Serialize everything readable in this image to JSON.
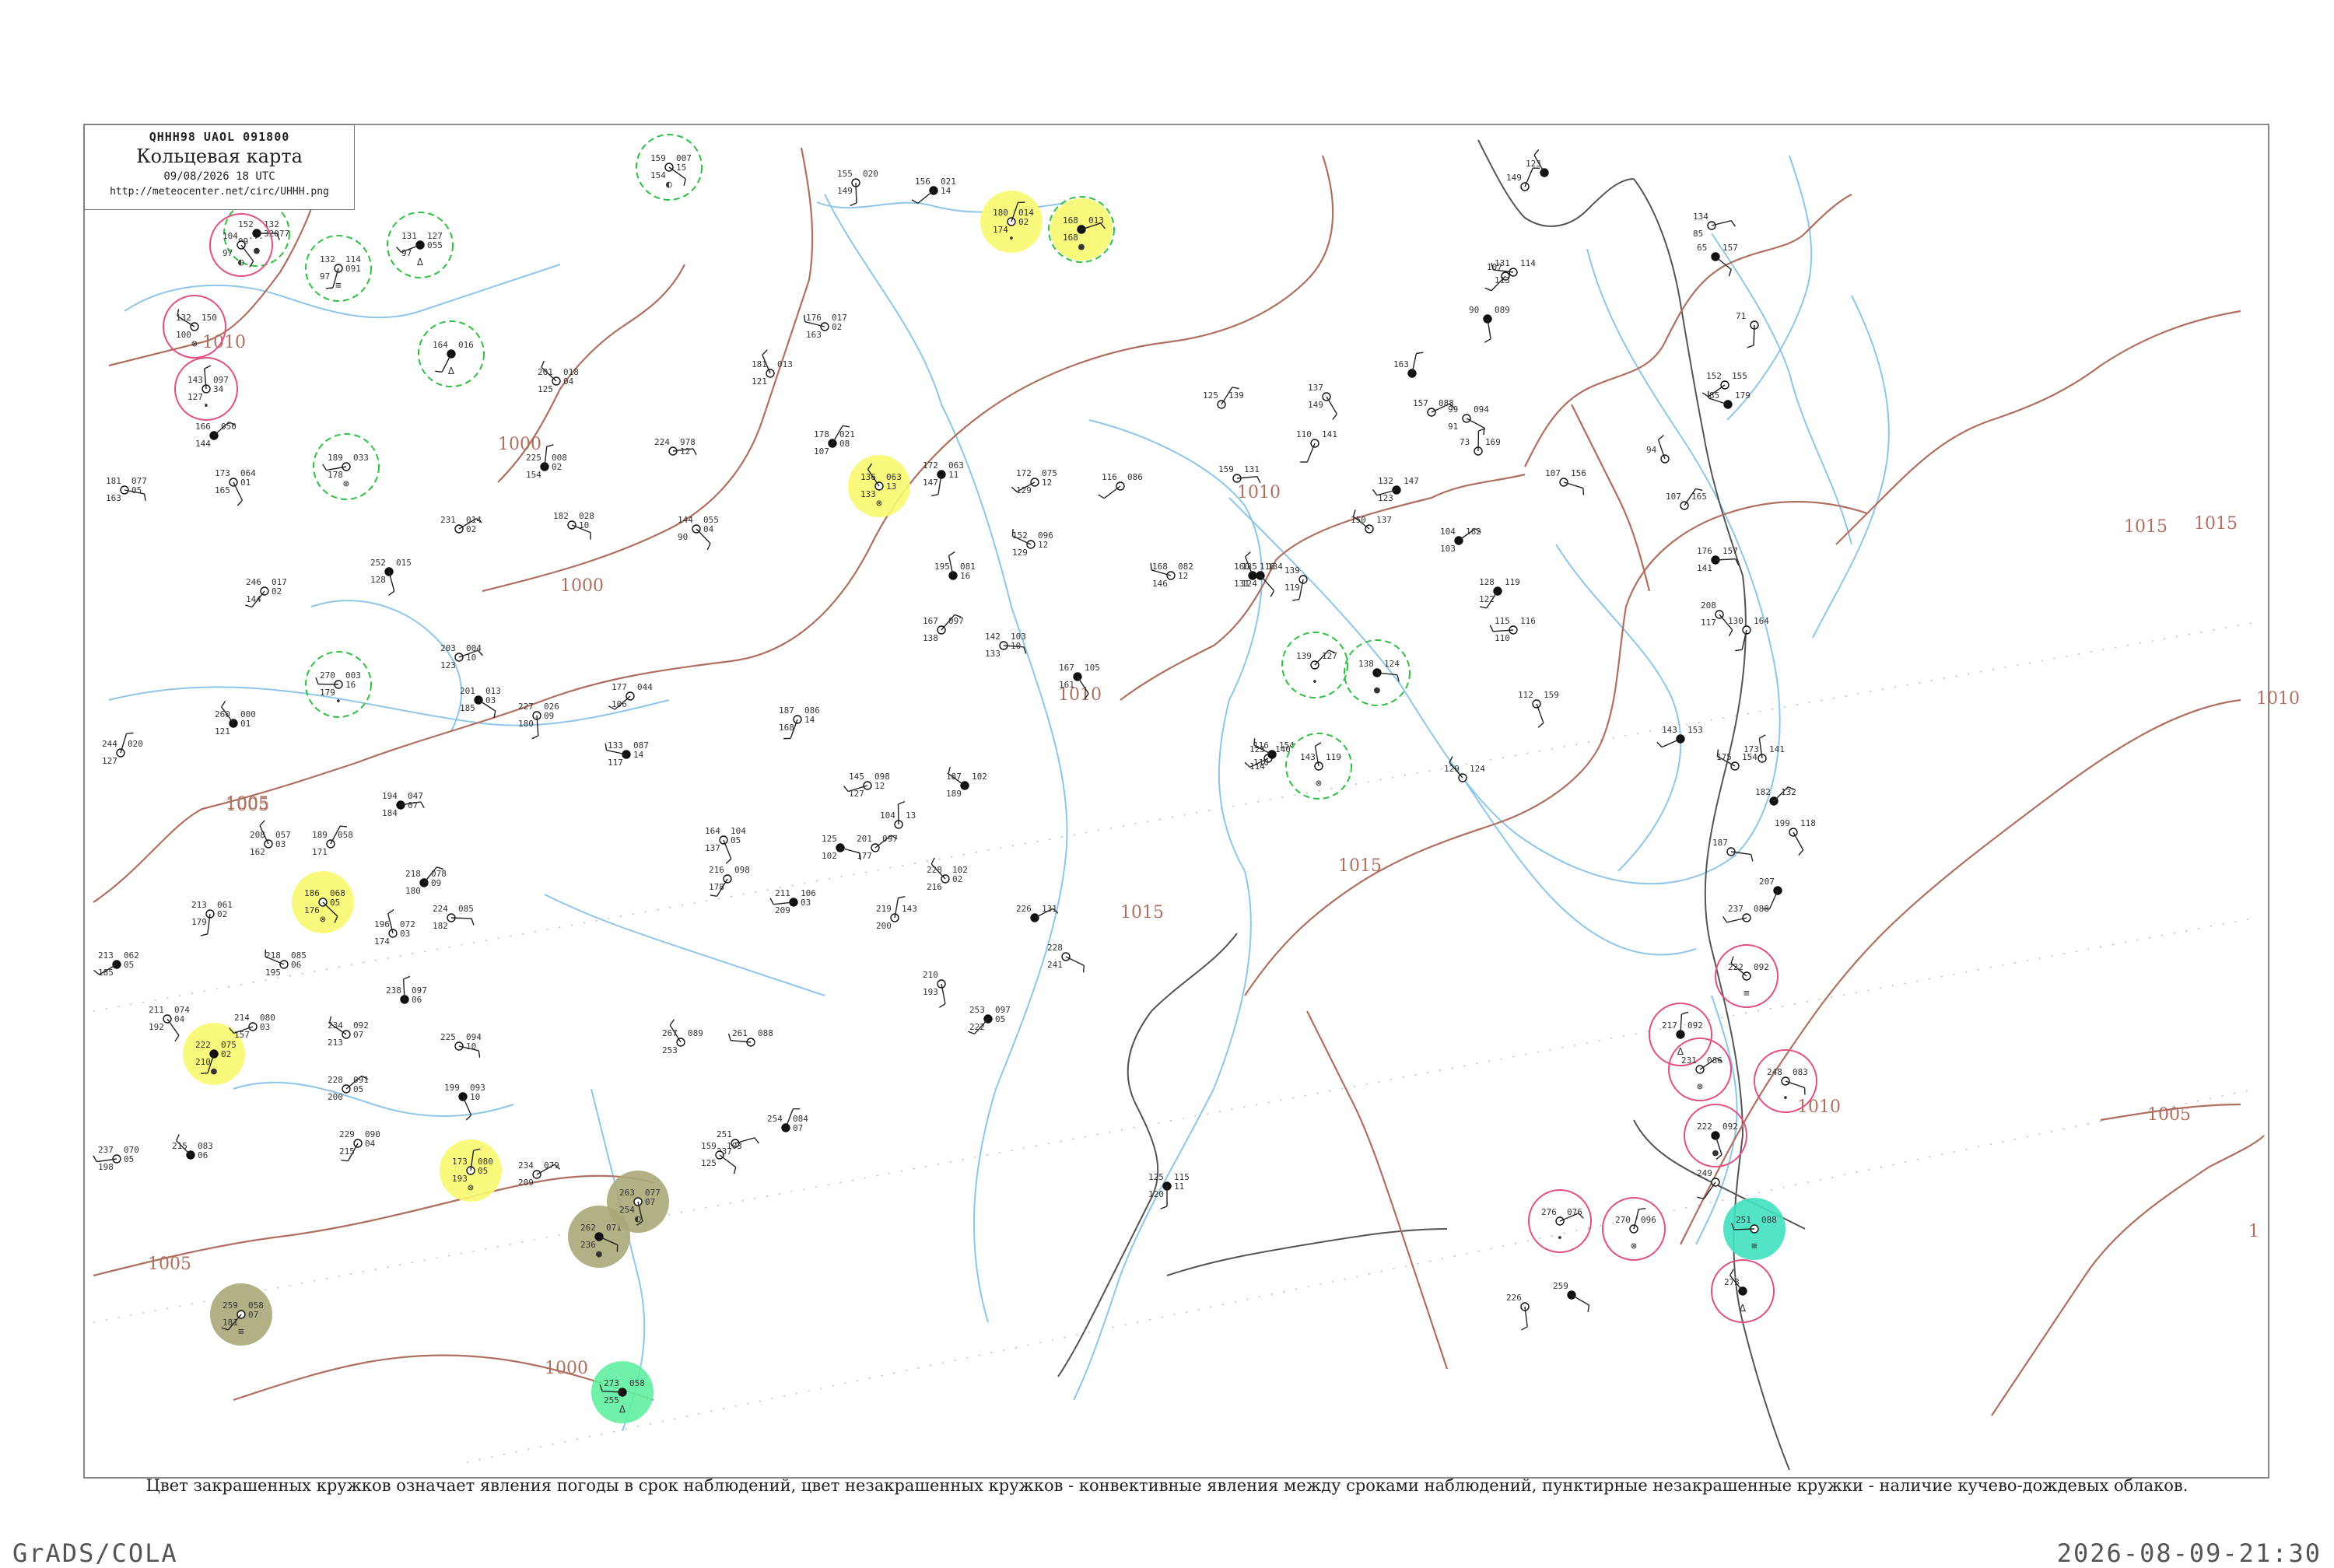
{
  "legend": {
    "code_line": "QHHH98  UAOL  091800",
    "title": "Кольцевая карта",
    "time": "09/08/2026 18 UTC",
    "url": "http://meteocenter.net/circ/UHHH.png"
  },
  "caption": "Цвет закрашенных кружков означает явления погоды в срок наблюдений, цвет незакрашенных кружков - конвективные явления между сроками наблюдений, пунктирные незакрашенные кружки - наличие кучево-дождевых облаков.",
  "footer": {
    "left": "GrADS/COLA",
    "right": "2026-08-09-21:30"
  },
  "colors": {
    "isobar": "#b07060",
    "river": "#8ec6ea",
    "coast": "#555555",
    "fill_thunder": "#14b83c",
    "fill_rain": "#f8f870",
    "fill_heavy": "#e8304c",
    "fill_fog": "#a8a878",
    "fill_mist": "#40e0c0",
    "fill_shower": "#60f0a0",
    "ring_conv": "#e05080",
    "ring_cb": "#2ec040"
  },
  "isobar_labels": [
    "1010",
    "1000",
    "1000",
    "1005",
    "1005",
    "1010",
    "1010",
    "1015",
    "1015",
    "1015",
    "1015",
    "1010",
    "1010",
    "1005",
    "1000",
    "1005",
    "1"
  ],
  "stations": [
    {
      "t": "152",
      "d": "99",
      "p": "132",
      "n": "32077",
      "fill": "",
      "ring": "cb"
    },
    {
      "t": "104",
      "d": "97",
      "p": "...",
      "n": "",
      "fill": "",
      "ring": "conv"
    },
    {
      "t": "132",
      "d": "97",
      "p": "114",
      "n": "091",
      "fill": "",
      "ring": "cb"
    },
    {
      "t": "131",
      "d": "97",
      "p": "127",
      "n": "055",
      "fill": "",
      "ring": "cb"
    },
    {
      "t": "132",
      "d": "100",
      "p": "150",
      "n": "",
      "fill": "",
      "ring": "conv"
    },
    {
      "t": "143",
      "d": "127",
      "p": "097",
      "n": "34",
      "fill": "",
      "ring": "conv"
    },
    {
      "t": "166",
      "d": "144",
      "p": "050",
      "n": "",
      "fill": "",
      "ring": ""
    },
    {
      "t": "181",
      "d": "163",
      "p": "077",
      "n": "05",
      "fill": "",
      "ring": ""
    },
    {
      "t": "173",
      "d": "165",
      "p": "064",
      "n": "01",
      "fill": "",
      "ring": ""
    },
    {
      "t": "164",
      "d": "",
      "p": "016",
      "n": "",
      "fill": "",
      "ring": "cb"
    },
    {
      "t": "189",
      "d": "178",
      "p": "033",
      "n": "",
      "fill": "",
      "ring": "cb"
    },
    {
      "t": "201",
      "d": "125",
      "p": "018",
      "n": "04",
      "fill": "",
      "ring": ""
    },
    {
      "t": "225",
      "d": "154",
      "p": "008",
      "n": "02",
      "fill": "",
      "ring": ""
    },
    {
      "t": "231",
      "d": "",
      "p": "014",
      "n": "02",
      "fill": "",
      "ring": ""
    },
    {
      "t": "182",
      "d": "",
      "p": "028",
      "n": "10",
      "fill": "",
      "ring": ""
    },
    {
      "t": "252",
      "d": "128",
      "p": "015",
      "n": "",
      "fill": "",
      "ring": ""
    },
    {
      "t": "246",
      "d": "144",
      "p": "017",
      "n": "02",
      "fill": "",
      "ring": ""
    },
    {
      "t": "270",
      "d": "179",
      "p": "003",
      "n": "16",
      "fill": "",
      "ring": "cb"
    },
    {
      "t": "260",
      "d": "121",
      "p": "000",
      "n": "01",
      "fill": "",
      "ring": ""
    },
    {
      "t": "244",
      "d": "127",
      "p": "020",
      "n": "",
      "fill": "",
      "ring": ""
    },
    {
      "t": "203",
      "d": "123",
      "p": "004",
      "n": "10",
      "fill": "",
      "ring": ""
    },
    {
      "t": "201",
      "d": "185",
      "p": "013",
      "n": "03",
      "fill": "",
      "ring": ""
    },
    {
      "t": "227",
      "d": "180",
      "p": "026",
      "n": "09",
      "fill": "",
      "ring": ""
    },
    {
      "t": "177",
      "d": "106",
      "p": "044",
      "n": "",
      "fill": "",
      "ring": ""
    },
    {
      "t": "133",
      "d": "117",
      "p": "087",
      "n": "14",
      "fill": "",
      "ring": ""
    },
    {
      "t": "208",
      "d": "162",
      "p": "057",
      "n": "03",
      "fill": "",
      "ring": ""
    },
    {
      "t": "189",
      "d": "171",
      "p": "058",
      "n": "",
      "fill": "",
      "ring": ""
    },
    {
      "t": "194",
      "d": "184",
      "p": "047",
      "n": "07",
      "fill": "",
      "ring": ""
    },
    {
      "t": "186",
      "d": "176",
      "p": "068",
      "n": "05",
      "fill": "rain",
      "ring": ""
    },
    {
      "t": "213",
      "d": "179",
      "p": "061",
      "n": "02",
      "fill": "",
      "ring": ""
    },
    {
      "t": "213",
      "d": "185",
      "p": "062",
      "n": "05",
      "fill": "",
      "ring": ""
    },
    {
      "t": "218",
      "d": "195",
      "p": "085",
      "n": "06",
      "fill": "",
      "ring": ""
    },
    {
      "t": "196",
      "d": "174",
      "p": "072",
      "n": "03",
      "fill": "",
      "ring": ""
    },
    {
      "t": "218",
      "d": "180",
      "p": "078",
      "n": "09",
      "fill": "",
      "ring": ""
    },
    {
      "t": "224",
      "d": "182",
      "p": "085",
      "n": "",
      "fill": "",
      "ring": ""
    },
    {
      "t": "211",
      "d": "192",
      "p": "074",
      "n": "04",
      "fill": "",
      "ring": ""
    },
    {
      "t": "222",
      "d": "210",
      "p": "075",
      "n": "02",
      "fill": "rain",
      "ring": ""
    },
    {
      "t": "214",
      "d": "157",
      "p": "080",
      "n": "03",
      "fill": "",
      "ring": ""
    },
    {
      "t": "234",
      "d": "213",
      "p": "092",
      "n": "07",
      "fill": "",
      "ring": ""
    },
    {
      "t": "238",
      "d": "",
      "p": "097",
      "n": "06",
      "fill": "",
      "ring": ""
    },
    {
      "t": "228",
      "d": "200",
      "p": "091",
      "n": "05",
      "fill": "",
      "ring": ""
    },
    {
      "t": "225",
      "d": "",
      "p": "094",
      "n": "10",
      "fill": "",
      "ring": ""
    },
    {
      "t": "199",
      "d": "",
      "p": "093",
      "n": "10",
      "fill": "",
      "ring": ""
    },
    {
      "t": "229",
      "d": "215",
      "p": "090",
      "n": "04",
      "fill": "",
      "ring": ""
    },
    {
      "t": "237",
      "d": "198",
      "p": "070",
      "n": "05",
      "fill": "",
      "ring": ""
    },
    {
      "t": "215",
      "d": "",
      "p": "083",
      "n": "06",
      "fill": "",
      "ring": ""
    },
    {
      "t": "173",
      "d": "193",
      "p": "080",
      "n": "05",
      "fill": "rain",
      "ring": ""
    },
    {
      "t": "234",
      "d": "209",
      "p": "079",
      "n": "",
      "fill": "",
      "ring": ""
    },
    {
      "t": "262",
      "d": "236",
      "p": "071",
      "n": "",
      "fill": "fog",
      "ring": ""
    },
    {
      "t": "263",
      "d": "254",
      "p": "077",
      "n": "07",
      "fill": "fog",
      "ring": ""
    },
    {
      "t": "259",
      "d": "181",
      "p": "058",
      "n": "07",
      "fill": "fog",
      "ring": ""
    },
    {
      "t": "273",
      "d": "255",
      "p": "058",
      "n": "",
      "fill": "shower",
      "ring": ""
    },
    {
      "t": "136",
      "d": "133",
      "p": "063",
      "n": "13",
      "fill": "rain",
      "ring": ""
    },
    {
      "t": "180",
      "d": "174",
      "p": "014",
      "n": "02",
      "fill": "rain",
      "ring": ""
    },
    {
      "t": "168",
      "d": "168",
      "p": "013",
      "n": "",
      "fill": "rain",
      "ring": "cb"
    },
    {
      "t": "159",
      "d": "154",
      "p": "007",
      "n": "15",
      "fill": "",
      "ring": "cb"
    },
    {
      "t": "155",
      "d": "149",
      "p": "020",
      "n": "",
      "fill": "",
      "ring": ""
    },
    {
      "t": "156",
      "d": "",
      "p": "021",
      "n": "14",
      "fill": "",
      "ring": ""
    },
    {
      "t": "176",
      "d": "163",
      "p": "017",
      "n": "02",
      "fill": "",
      "ring": ""
    },
    {
      "t": "181",
      "d": "121",
      "p": "013",
      "n": "",
      "fill": "",
      "ring": ""
    },
    {
      "t": "178",
      "d": "107",
      "p": "021",
      "n": "08",
      "fill": "",
      "ring": ""
    },
    {
      "t": "224",
      "d": "",
      "p": "978",
      "n": "12",
      "fill": "",
      "ring": ""
    },
    {
      "t": "144",
      "d": "90",
      "p": "055",
      "n": "04",
      "fill": "",
      "ring": ""
    },
    {
      "t": "172",
      "d": "147",
      "p": "063",
      "n": "11",
      "fill": "",
      "ring": ""
    },
    {
      "t": "172",
      "d": "129",
      "p": "075",
      "n": "12",
      "fill": "",
      "ring": ""
    },
    {
      "t": "152",
      "d": "129",
      "p": "096",
      "n": "12",
      "fill": "",
      "ring": ""
    },
    {
      "t": "195",
      "d": "",
      "p": "081",
      "n": "16",
      "fill": "",
      "ring": ""
    },
    {
      "t": "167",
      "d": "138",
      "p": "097",
      "n": "",
      "fill": "",
      "ring": ""
    },
    {
      "t": "142",
      "d": "133",
      "p": "103",
      "n": "10",
      "fill": "",
      "ring": ""
    },
    {
      "t": "167",
      "d": "161",
      "p": "105",
      "n": "",
      "fill": "",
      "ring": ""
    },
    {
      "t": "187",
      "d": "168",
      "p": "086",
      "n": "14",
      "fill": "",
      "ring": ""
    },
    {
      "t": "145",
      "d": "127",
      "p": "098",
      "n": "12",
      "fill": "",
      "ring": ""
    },
    {
      "t": "187",
      "d": "189",
      "p": "102",
      "n": "",
      "fill": "",
      "ring": ""
    },
    {
      "t": "104",
      "d": "",
      "p": "13",
      "n": "",
      "fill": "",
      "ring": ""
    },
    {
      "t": "201",
      "d": "177",
      "p": "097",
      "n": "",
      "fill": "",
      "ring": ""
    },
    {
      "t": "125",
      "d": "102",
      "p": "",
      "n": "",
      "fill": "",
      "ring": ""
    },
    {
      "t": "164",
      "d": "137",
      "p": "104",
      "n": "05",
      "fill": "",
      "ring": ""
    },
    {
      "t": "216",
      "d": "178",
      "p": "098",
      "n": "",
      "fill": "",
      "ring": ""
    },
    {
      "t": "211",
      "d": "209",
      "p": "106",
      "n": "03",
      "fill": "",
      "ring": ""
    },
    {
      "t": "228",
      "d": "216",
      "p": "102",
      "n": "02",
      "fill": "",
      "ring": ""
    },
    {
      "t": "219",
      "d": "200",
      "p": "143",
      "n": "",
      "fill": "",
      "ring": ""
    },
    {
      "t": "226",
      "d": "",
      "p": "131",
      "n": "",
      "fill": "",
      "ring": ""
    },
    {
      "t": "228",
      "d": "241",
      "p": "",
      "n": "",
      "fill": "",
      "ring": ""
    },
    {
      "t": "210",
      "d": "193",
      "p": "",
      "n": "",
      "fill": "",
      "ring": ""
    },
    {
      "t": "253",
      "d": "222",
      "p": "097",
      "n": "05",
      "fill": "",
      "ring": ""
    },
    {
      "t": "261",
      "d": "",
      "p": "088",
      "n": "",
      "fill": "",
      "ring": ""
    },
    {
      "t": "267",
      "d": "253",
      "p": "089",
      "n": "",
      "fill": "",
      "ring": ""
    },
    {
      "t": "254",
      "d": "",
      "p": "084",
      "n": "07",
      "fill": "",
      "ring": ""
    },
    {
      "t": "251",
      "d": "237",
      "p": "",
      "n": "",
      "fill": "",
      "ring": ""
    },
    {
      "t": "159",
      "d": "125",
      "p": "103",
      "n": "",
      "fill": "",
      "ring": ""
    },
    {
      "t": "125",
      "d": "120",
      "p": "115",
      "n": "11",
      "fill": "",
      "ring": ""
    },
    {
      "t": "116",
      "d": "",
      "p": "086",
      "n": "",
      "fill": "",
      "ring": ""
    },
    {
      "t": "168",
      "d": "146",
      "p": "082",
      "n": "12",
      "fill": "",
      "ring": ""
    },
    {
      "t": "160",
      "d": "131",
      "p": "116",
      "n": "",
      "fill": "",
      "ring": ""
    },
    {
      "t": "125",
      "d": "",
      "p": "139",
      "n": "",
      "fill": "",
      "ring": ""
    },
    {
      "t": "159",
      "d": "",
      "p": "131",
      "n": "",
      "fill": "",
      "ring": ""
    },
    {
      "t": "135",
      "d": "124",
      "p": "134",
      "n": "",
      "fill": "",
      "ring": ""
    },
    {
      "t": "139",
      "d": "119",
      "p": "",
      "n": "",
      "fill": "",
      "ring": ""
    },
    {
      "t": "123",
      "d": "114",
      "p": "140",
      "n": "",
      "fill": "",
      "ring": ""
    },
    {
      "t": "116",
      "d": "110",
      "p": "154",
      "n": "",
      "fill": "",
      "ring": ""
    },
    {
      "t": "143",
      "d": "",
      "p": "119",
      "n": "",
      "fill": "",
      "ring": "cb"
    },
    {
      "t": "139",
      "d": "",
      "p": "127",
      "n": "",
      "fill": "",
      "ring": "cb"
    },
    {
      "t": "138",
      "d": "",
      "p": "124",
      "n": "",
      "fill": "",
      "ring": "cb"
    },
    {
      "t": "137",
      "d": "149",
      "p": "",
      "n": "",
      "fill": "",
      "ring": ""
    },
    {
      "t": "110",
      "d": "",
      "p": "141",
      "n": "",
      "fill": "",
      "ring": ""
    },
    {
      "t": "132",
      "d": "123",
      "p": "147",
      "n": "",
      "fill": "",
      "ring": ""
    },
    {
      "t": "150",
      "d": "",
      "p": "137",
      "n": "",
      "fill": "",
      "ring": ""
    },
    {
      "t": "73",
      "d": "",
      "p": "169",
      "n": "",
      "fill": "",
      "ring": ""
    },
    {
      "t": "104",
      "d": "103",
      "p": "162",
      "n": "",
      "fill": "",
      "ring": ""
    },
    {
      "t": "107",
      "d": "",
      "p": "156",
      "n": "",
      "fill": "",
      "ring": ""
    },
    {
      "t": "112",
      "d": "",
      "p": "159",
      "n": "",
      "fill": "",
      "ring": ""
    },
    {
      "t": "128",
      "d": "122",
      "p": "119",
      "n": "",
      "fill": "",
      "ring": ""
    },
    {
      "t": "115",
      "d": "110",
      "p": "116",
      "n": "",
      "fill": "",
      "ring": ""
    },
    {
      "t": "129",
      "d": "",
      "p": "124",
      "n": "",
      "fill": "",
      "ring": ""
    },
    {
      "t": "163",
      "d": "",
      "p": "",
      "n": "",
      "fill": "",
      "ring": ""
    },
    {
      "t": "157",
      "d": "",
      "p": "088",
      "n": "",
      "fill": "",
      "ring": ""
    },
    {
      "t": "99",
      "d": "91",
      "p": "094",
      "n": "",
      "fill": "",
      "ring": ""
    },
    {
      "t": "90",
      "d": "",
      "p": "089",
      "n": "",
      "fill": "",
      "ring": ""
    },
    {
      "t": "107",
      "d": "",
      "p": "",
      "n": "",
      "fill": "",
      "ring": ""
    },
    {
      "t": "131",
      "d": "113",
      "p": "114",
      "n": "",
      "fill": "",
      "ring": ""
    },
    {
      "t": "123",
      "d": "",
      "p": "",
      "n": "",
      "fill": "",
      "ring": ""
    },
    {
      "t": "149",
      "d": "",
      "p": "",
      "n": "",
      "fill": "",
      "ring": ""
    },
    {
      "t": "134",
      "d": "85",
      "p": "",
      "n": "",
      "fill": "",
      "ring": ""
    },
    {
      "t": "65",
      "d": "",
      "p": "157",
      "n": "",
      "fill": "",
      "ring": ""
    },
    {
      "t": "71",
      "d": "",
      "p": "",
      "n": "",
      "fill": "",
      "ring": ""
    },
    {
      "t": "152",
      "d": "",
      "p": "155",
      "n": "",
      "fill": "",
      "ring": ""
    },
    {
      "t": "85",
      "d": "",
      "p": "179",
      "n": "",
      "fill": "",
      "ring": ""
    },
    {
      "t": "94",
      "d": "",
      "p": "",
      "n": "",
      "fill": "",
      "ring": ""
    },
    {
      "t": "107",
      "d": "",
      "p": "165",
      "n": "",
      "fill": "",
      "ring": ""
    },
    {
      "t": "176",
      "d": "141",
      "p": "157",
      "n": "",
      "fill": "",
      "ring": ""
    },
    {
      "t": "208",
      "d": "117",
      "p": "",
      "n": "",
      "fill": "",
      "ring": ""
    },
    {
      "t": "130",
      "d": "",
      "p": "164",
      "n": "",
      "fill": "",
      "ring": ""
    },
    {
      "t": "143",
      "d": "",
      "p": "153",
      "n": "",
      "fill": "",
      "ring": ""
    },
    {
      "t": "175",
      "d": "",
      "p": "154",
      "n": "",
      "fill": "",
      "ring": ""
    },
    {
      "t": "173",
      "d": "",
      "p": "141",
      "n": "",
      "fill": "",
      "ring": ""
    },
    {
      "t": "182",
      "d": "",
      "p": "132",
      "n": "",
      "fill": "",
      "ring": ""
    },
    {
      "t": "187",
      "d": "",
      "p": "",
      "n": "",
      "fill": "",
      "ring": ""
    },
    {
      "t": "199",
      "d": "",
      "p": "118",
      "n": "",
      "fill": "",
      "ring": ""
    },
    {
      "t": "207",
      "d": "",
      "p": "",
      "n": "",
      "fill": "",
      "ring": ""
    },
    {
      "t": "237",
      "d": "",
      "p": "088",
      "n": "",
      "fill": "",
      "ring": ""
    },
    {
      "t": "222",
      "d": "",
      "p": "092",
      "n": "",
      "fill": "",
      "ring": "conv"
    },
    {
      "t": "217",
      "d": "",
      "p": "092",
      "n": "",
      "fill": "",
      "ring": "conv"
    },
    {
      "t": "231",
      "d": "",
      "p": "086",
      "n": "",
      "fill": "",
      "ring": "conv"
    },
    {
      "t": "248",
      "d": "",
      "p": "083",
      "n": "",
      "fill": "",
      "ring": "conv"
    },
    {
      "t": "222",
      "d": "",
      "p": "092",
      "n": "",
      "fill": "",
      "ring": "conv"
    },
    {
      "t": "249",
      "d": "",
      "p": "",
      "n": "",
      "fill": "",
      "ring": ""
    },
    {
      "t": "251",
      "d": "",
      "p": "088",
      "n": "",
      "fill": "mist",
      "ring": ""
    },
    {
      "t": "273",
      "d": "",
      "p": "",
      "n": "",
      "fill": "",
      "ring": "conv"
    },
    {
      "t": "270",
      "d": "",
      "p": "096",
      "n": "",
      "fill": "",
      "ring": "conv"
    },
    {
      "t": "276",
      "d": "",
      "p": "076",
      "n": "",
      "fill": "",
      "ring": "conv"
    },
    {
      "t": "259",
      "d": "",
      "p": "",
      "n": "",
      "fill": "",
      "ring": ""
    },
    {
      "t": "226",
      "d": "",
      "p": "",
      "n": "",
      "fill": "",
      "ring": ""
    }
  ]
}
